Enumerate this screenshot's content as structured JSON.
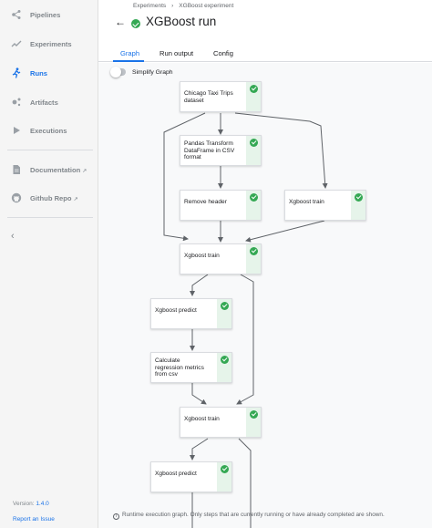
{
  "sidebar": {
    "items": [
      {
        "label": "Pipelines",
        "icon": "pipelines-icon"
      },
      {
        "label": "Experiments",
        "icon": "experiments-icon"
      },
      {
        "label": "Runs",
        "icon": "runs-icon",
        "active": true
      },
      {
        "label": "Artifacts",
        "icon": "artifacts-icon"
      },
      {
        "label": "Executions",
        "icon": "executions-icon"
      }
    ],
    "links": [
      {
        "label": "Documentation",
        "icon": "documentation-icon"
      },
      {
        "label": "Github Repo",
        "icon": "github-icon"
      }
    ],
    "version_label": "Version:",
    "version_value": "1.4.0",
    "report_label": "Report an Issue"
  },
  "header": {
    "breadcrumb": [
      "Experiments",
      "XGBoost experiment"
    ],
    "breadcrumb_sep": "›",
    "title": "XGBoost run",
    "back_glyph": "←"
  },
  "tabs": [
    "Graph",
    "Run output",
    "Config"
  ],
  "graph": {
    "toggle_label": "Simplify Graph",
    "nodes": [
      {
        "id": "n1",
        "label_lines": [
          "Chicago Taxi Trips",
          "dataset"
        ],
        "status": "succeeded"
      },
      {
        "id": "n2",
        "label_lines": [
          "Pandas Transform",
          "DataFrame in CSV",
          "format"
        ],
        "status": "succeeded"
      },
      {
        "id": "n3",
        "label_lines": [
          "Remove header"
        ],
        "status": "succeeded"
      },
      {
        "id": "n4",
        "label_lines": [
          "Xgboost train"
        ],
        "status": "succeeded"
      },
      {
        "id": "n5",
        "label_lines": [
          "Xgboost train"
        ],
        "status": "succeeded"
      },
      {
        "id": "n6",
        "label_lines": [
          "Xgboost predict"
        ],
        "status": "succeeded"
      },
      {
        "id": "n7",
        "label_lines": [
          "Calculate",
          "regression metrics",
          "from csv"
        ],
        "status": "succeeded"
      },
      {
        "id": "n8",
        "label_lines": [
          "Xgboost train"
        ],
        "status": "succeeded"
      },
      {
        "id": "n9",
        "label_lines": [
          "Xgboost predict"
        ],
        "status": "succeeded"
      }
    ],
    "footnote": "Runtime execution graph. Only steps that are currently running or have already completed are shown."
  },
  "colors": {
    "accent": "#1a73e8",
    "success": "#34a853",
    "success_bg": "#e6f4ea"
  }
}
